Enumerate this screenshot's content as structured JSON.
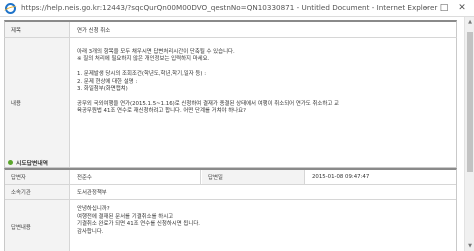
{
  "window": {
    "title": "https://help.neis.go.kr:12443/?sqcQurQn00M00DVO_qestnNo=QN10330871 - Untitled Document - Internet Explorer",
    "controls": [
      "–",
      "□",
      "✕"
    ]
  },
  "question": {
    "subject_label": "제목",
    "subject_value": "연가 신청 취소",
    "body_label": "내용",
    "body_lines": [
      "아래 3개의 항목을 모두 채우시면 답변처리시간이 단축될 수 있습니다.",
      "※ 질의 처리에 필요하지 않은 개인정보는 입력하지 마세요.",
      "",
      "1. 문제발생 당시의 조회조건(학년도,학년,학기,일자 등) :",
      "2. 문제 현상에 대한 설명 :",
      "3. 화일첨부(화면캡쳐)",
      "",
      "공무외 국외여행을 연가(2015.1.5~1.16)로 신청하여 결재가 종결된 상태에서 여행이 취소되어 연가도 취소하고 교",
      "육공무원법 41조 연수로 재신청하려고 합니다. 어떤 단계를 거쳐야 하나요?"
    ]
  },
  "answer": {
    "section_title": "시도답변내역",
    "answerer_label": "답변자",
    "answerer_value": "전준수",
    "date_label": "답변일",
    "date_value": "2015-01-08 09:47:47",
    "dept_label": "소속기관",
    "dept_value": "도서관정책부",
    "content_label": "답변내용",
    "content_lines": [
      "안녕하십니까?",
      "여행전에 결재된 문서를 기결취소를 하시고",
      "기결취소 완료가 되면 41조 연수를 신청하시면 됩니다.",
      "감사합니다."
    ]
  },
  "colors": {
    "table_border": "#8a8a8a",
    "label_bg": "#f3f3f3",
    "section_bullet": "#5ba52c",
    "ie_blue": "#1e73c9"
  }
}
